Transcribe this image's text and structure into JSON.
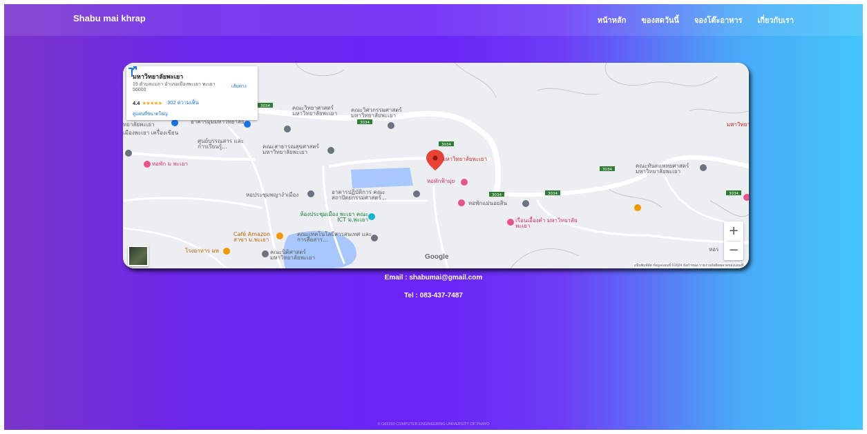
{
  "navbar": {
    "brand": "Shabu mai khrap",
    "links": [
      "หน้าหลัก",
      "ของสดวันนี้",
      "จองโต๊ะอาหาร",
      "เกี่ยวกับเรา"
    ]
  },
  "map": {
    "place_name": "มหาวิทยาลัยพะเยา",
    "address": "19 ตำบลแม่กา อำเภอเมืองพะเยา พะเยา 56000",
    "rating": "4.4",
    "stars": "★★★★★",
    "reviews": "302 ความเห็น",
    "directions_label": "เส้นทาง",
    "larger_map_label": "ดูแผนที่ขนาดใหญ่",
    "google_logo": "Google",
    "attribution": "แป้นพิมพ์ลัด  ข้อมูลแผนที่ ©2024  ข้อกำหนด  รายงานข้อผิดพลาดของแผนที่",
    "zoom_in": "+",
    "zoom_out": "−",
    "road_number": "3034",
    "labels": {
      "main_marker": "มหาวิทยาลัยพะเยา",
      "science": "คณะวิทยาศาสตร์ มหาวิทยาลัยพะเยา",
      "engineering": "คณะวิศวกรรมศาสตร์ มหาวิทยาลัยพะเยา",
      "learning_center": "ศูนย์บรรณสาร และการเรียนรู้...",
      "public_health": "คณะสาธารณสุขศาสตร์ มหาวิทยาลัยพะเยา",
      "dorm_mor": "หอพัก ม พะเยา",
      "phayao_uni_left": "ทยาลัยพะเยา",
      "phayao_city": "เมืองพะเยา เครื่องเขียน",
      "phayao_uni_right": "มหาวิทยาลัยพะเยา",
      "dental": "คณะทันตแพทยศาสตร์ มหาวิทยาลัยพะเยา",
      "dorm_fah": "หอพักฟ้ามุ่ย",
      "architecture": "อาคารปฏิบัติการ คณะ สถาปัตยกรรมศาสตร์...",
      "dorm_mae": "หอพักแม่นอยสิน",
      "assembly": "หอประชุมพญางำเมือง",
      "ict_hall": "ห้องประชุมเมือง พะเยา คณะ ICT ม.พะเยา",
      "ruan": "เรือนเอื้องคำ มหาวิทยาลัยพะเยา",
      "cafe": "Café Amazon สาขา ม.พะเยา",
      "it_faculty": "คณะเทคโนโลยีสารสนเทศ และการสื่อสาร...",
      "restaurant": "โรงอาหาร มพ",
      "law": "คณะนิติศาสตร์ มหาวิทยาลัยพะเยา",
      "mor_top": "อาคารมุมมหาวิทยาลัย",
      "far_right": "หอร"
    }
  },
  "contact": {
    "email": "Email : shabumai@gmail.com",
    "tel": "Tel : 083-437-7487"
  },
  "footer": "© G65203 COMPUTER ENGINEERING UNIVERSITY OF PHAYO"
}
